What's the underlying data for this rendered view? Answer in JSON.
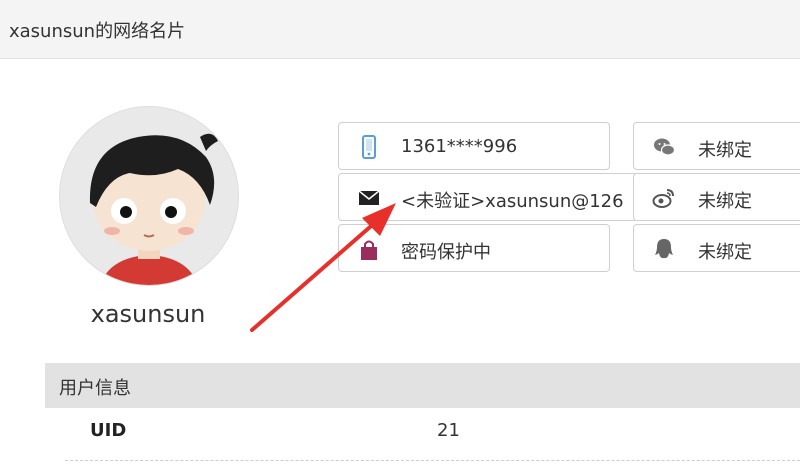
{
  "header": {
    "title": "xasunsun的网络名片"
  },
  "profile": {
    "username": "xasunsun"
  },
  "bindings": {
    "phone": {
      "icon": "phone-icon",
      "value": "1361****996"
    },
    "email": {
      "icon": "envelope-icon",
      "value": "<未验证>xasunsun@126"
    },
    "password": {
      "icon": "lock-icon",
      "value": "密码保护中"
    },
    "wechat": {
      "icon": "wechat-icon",
      "value": "未绑定"
    },
    "weibo": {
      "icon": "weibo-icon",
      "value": "未绑定"
    },
    "qq": {
      "icon": "qq-icon",
      "value": "未绑定"
    }
  },
  "user_info": {
    "heading": "用户信息",
    "rows": [
      {
        "label": "UID",
        "value": "21"
      }
    ]
  },
  "colors": {
    "annotation_arrow": "#e8302a",
    "phone_icon": "#5a9fd4",
    "lock_icon": "#9b2d5e",
    "social_icon": "#777777"
  }
}
